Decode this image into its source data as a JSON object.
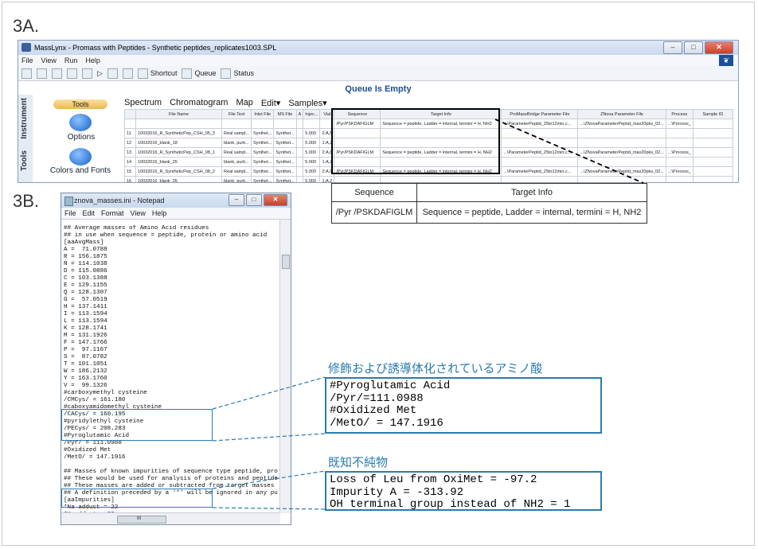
{
  "labels": {
    "fig_a": "3A.",
    "fig_b": "3B."
  },
  "masslynx": {
    "title": "MassLynx - Promass with Peptides - Synthetic peptides_replicates1003.SPL",
    "menu": [
      "File",
      "View",
      "Run",
      "Help"
    ],
    "toolbar": {
      "shortcut": "Shortcut",
      "queue": "Queue",
      "status": "Status"
    },
    "queue_status": "Queue Is Empty",
    "side_tabs": {
      "instrument": "Instrument",
      "tools": "Tools"
    },
    "tools_header": "Tools",
    "tool_options": "Options",
    "tool_colors": "Colors and Fonts",
    "spectrum_menu": [
      "Spectrum",
      "Chromatogram",
      "Map",
      "Edit▾",
      "Samples▾"
    ],
    "columns": [
      "",
      "File Name",
      "File Text",
      "Inlet File",
      "MS File",
      "A",
      "Injec...",
      "Vial",
      "Sequence",
      "Target Info",
      "ProMassBridge Parameter File",
      "ZNova Parameter File",
      "Process",
      "Sample ID"
    ],
    "rows": [
      [
        "11",
        "10032016_R_SyntheticPep_CSH_05_3",
        "Real sampl...",
        "Synthet...",
        "Synthet...",
        "",
        "5.000",
        "2:A,5",
        "",
        "",
        "",
        "",
        "",
        ""
      ],
      [
        "12",
        "10032016_blank_18",
        "blank, purit...",
        "Synthet...",
        "Synthet...",
        "",
        "5.000",
        "1:A,2",
        "",
        "",
        "",
        "",
        "",
        ""
      ],
      [
        "13",
        "10032016_R_SyntheticPep_CSH_08_1",
        "Real sampl...",
        "Synthet...",
        "Synthet...",
        "",
        "5.000",
        "2:A,8",
        "/Pyr/PSKDAFIGLM",
        "Sequence = peptide, Ladder = internal, termini = H, NH2",
        "...\\ParameterPeptid_25to12min.c...",
        "...\\ZNovaParameterPeptid_max20pks_02...",
        "...\\Process_",
        ""
      ],
      [
        "14",
        "10032016_blank_25",
        "blank, purit...",
        "Synthet...",
        "Synthet...",
        "",
        "5.000",
        "1:A,2",
        "",
        "",
        "",
        "",
        "",
        ""
      ],
      [
        "15",
        "10032016_R_SyntheticPep_CSH_08_2",
        "Real sampl...",
        "Synthet...",
        "Synthet...",
        "",
        "5.000",
        "2:A,8",
        "/Pyr/PSKDAFIGLM",
        "Sequence = peptide, Ladder = internal, termini = H, NH2",
        "...\\ParameterPeptid_25to12min.c...",
        "...\\ZNovaParameterPeptid_max20pks_02...",
        "...\\Process_",
        ""
      ],
      [
        "16",
        "10032016_blank_26",
        "blank, purit...",
        "Synthet...",
        "Synthet...",
        "",
        "5.000",
        "1:A,2",
        "",
        "",
        "",
        "",
        "",
        ""
      ]
    ],
    "row10": [
      "/Pyr/PSKDAFIGLM",
      "Sequence = peptide, Ladder = internal, termini = H, NH2",
      "...\\ParameterPeptid_25to12min.c...",
      "...\\ZNovaParameterPeptid_max20pks_02...",
      "...\\Process_"
    ]
  },
  "callout_table": {
    "headers": [
      "Sequence",
      "Target Info"
    ],
    "sequence": "/Pyr /PSKDAFIGLM",
    "target_info": "Sequence = peptide, Ladder = internal, termini = H, NH2"
  },
  "notepad": {
    "title": "znova_masses.ini - Notepad",
    "menu": [
      "File",
      "Edit",
      "Format",
      "View",
      "Help"
    ],
    "lines": [
      "## Average masses of Amino Acid residues",
      "## in use when sequence = peptide, protein or amino acid",
      "[aaAvgMass]",
      "A =  71.0788",
      "R = 156.1875",
      "N = 114.1038",
      "D = 115.0886",
      "C = 103.1388",
      "E = 129.1155",
      "Q = 128.1307",
      "G =  57.0519",
      "H = 137.1411",
      "I = 113.1594",
      "L = 113.1594",
      "K = 128.1741",
      "M = 131.1926",
      "F = 147.1766",
      "P =  97.1167",
      "S =  87.0782",
      "T = 101.1051",
      "W = 186.2132",
      "Y = 163.1760",
      "V =  99.1326",
      "#carboxymethyl cysteine",
      "/CMCys/ = 161.180",
      "#caboxyamidomethyl cysteine",
      "/CACys/ = 160.195",
      "#pyridylethyl cysteine",
      "/PECys/ = 208.283",
      "#Pyroglutamic Acid",
      "/Pyr/ = 111.0988",
      "#Oxidized Met",
      "/MetO/ = 147.1916",
      "",
      "## Masses of known impurities of sequence type peptide, pro",
      "## These would be used for analysis of proteins and peptide",
      "## These masses are added or subtracted from target masses",
      "## A definition preceded by a '*' will be ignored in any pu",
      "[aaImpurities]",
      "*Na adduct = 22",
      "*K adduct = 38",
      "Oxidation = 16",
      "Loss of Leu from OxiMet = -97.2",
      "Impurity A = -313.92",
      "OH terminal group instead of NH2 = 1"
    ],
    "scroll_mark": "III"
  },
  "zoom_mod": {
    "heading": "修飾および誘導体化されているアミノ酸",
    "lines": [
      "#Pyroglutamic Acid",
      "/Pyr/=111.0988",
      "#Oxidized Met",
      "/MetO/ = 147.1916"
    ]
  },
  "zoom_imp": {
    "heading": "既知不純物",
    "lines": [
      "Loss of Leu from OxiMet = -97.2",
      "Impurity A = -313.92",
      "OH terminal group instead of NH2 = 1"
    ]
  },
  "colors": {
    "accent": "#2a7bb0",
    "queue_text": "#1d4e8f"
  }
}
